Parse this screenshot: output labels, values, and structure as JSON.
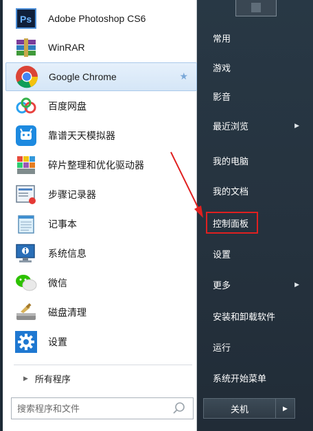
{
  "programs": [
    {
      "label": "Adobe Photoshop CS6",
      "icon": "photoshop-icon"
    },
    {
      "label": "WinRAR",
      "icon": "winrar-icon"
    },
    {
      "label": "Google Chrome",
      "icon": "chrome-icon",
      "selected": true,
      "pinned": true
    },
    {
      "label": "百度网盘",
      "icon": "baidu-netdisk-icon"
    },
    {
      "label": "靠谱天天模拟器",
      "icon": "emulator-icon"
    },
    {
      "label": "碎片整理和优化驱动器",
      "icon": "defrag-icon"
    },
    {
      "label": "步骤记录器",
      "icon": "steps-recorder-icon"
    },
    {
      "label": "记事本",
      "icon": "notepad-icon"
    },
    {
      "label": "系统信息",
      "icon": "system-info-icon"
    },
    {
      "label": "微信",
      "icon": "wechat-icon"
    },
    {
      "label": "磁盘清理",
      "icon": "disk-cleanup-icon"
    },
    {
      "label": "设置",
      "icon": "settings-gear-icon"
    }
  ],
  "pin_symbol": "★",
  "all_programs": {
    "label": "所有程序",
    "arrow": "▶"
  },
  "search": {
    "placeholder": "搜索程序和文件",
    "icon": "search-icon"
  },
  "right_menu": [
    {
      "label": "常用"
    },
    {
      "label": "游戏"
    },
    {
      "label": "影音"
    },
    {
      "label": "最近浏览",
      "arrow": "▶"
    },
    {
      "label": "我的电脑"
    },
    {
      "label": "我的文档"
    },
    {
      "label": "控制面板",
      "highlighted": true
    },
    {
      "label": "设置"
    },
    {
      "label": "更多",
      "arrow": "▶"
    },
    {
      "label": "安装和卸载软件"
    },
    {
      "label": "运行"
    },
    {
      "label": "系统开始菜单"
    }
  ],
  "shutdown": {
    "label": "关机",
    "arrow": "▶"
  },
  "colors": {
    "accent_highlight": "#e02020",
    "selected_bg": "#d5e6f7",
    "right_pane_bg": "#283845"
  }
}
